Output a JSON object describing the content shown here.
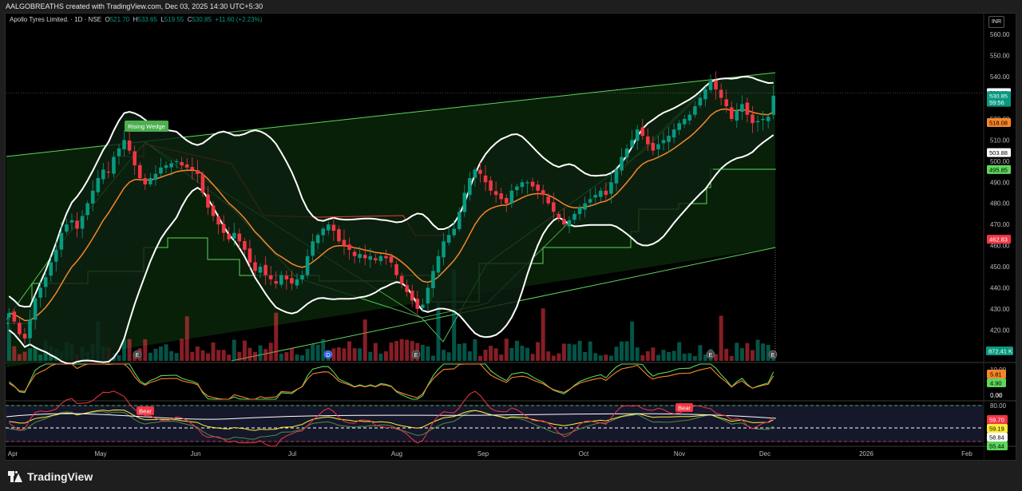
{
  "header": {
    "attribution": "AALGOBREATHS created with TradingView.com, Dec 03, 2025 14:30 UTC+5:30"
  },
  "legend": {
    "symbol": "Apollo Tyres Limited. · 1D · NSE",
    "o_label": "O",
    "o": "521.70",
    "h_label": "H",
    "h": "533.65",
    "l_label": "L",
    "l": "519.55",
    "c_label": "C",
    "c": "530.85",
    "change": "+11.60 (+2.23%)"
  },
  "currency": "INR",
  "wedge_label": "Rising Wedge",
  "bear_labels": [
    "Bear",
    "Bear"
  ],
  "event_markers": [
    "E",
    "D",
    "E",
    "E",
    "E"
  ],
  "footer": {
    "brand": "TradingView"
  },
  "colors": {
    "bull": "#089981",
    "bear": "#f23645",
    "bb": "#ffffff",
    "ema": "#f7862a",
    "trend": "#5cd65c",
    "wedge_fill": "#0b2b0b",
    "zone_fill": "#0d1f10",
    "rsi_bg": "#15172a"
  },
  "chart_data": [
    {
      "type": "candlestick",
      "x_labels": [
        "Apr",
        "May",
        "Jun",
        "Jul",
        "Aug",
        "Sep",
        "Oct",
        "Nov",
        "Dec",
        "2026",
        "Feb"
      ],
      "y_ticks": [
        560,
        550,
        540,
        520,
        510,
        500,
        490,
        480,
        470,
        460,
        450,
        440,
        430,
        420,
        410
      ],
      "ylim": [
        405,
        565
      ],
      "price_badges": [
        {
          "label": "532.28",
          "value": 532.28,
          "color": "#ffffff",
          "text": "#000000"
        },
        {
          "label": "530.85",
          "value": 530.85,
          "color": "#089981",
          "text": "#ffffff"
        },
        {
          "label": "59:56",
          "value": 527.7,
          "color": "#089981",
          "text": "#ffffff"
        },
        {
          "label": "518.08",
          "value": 518.08,
          "color": "#f7862a",
          "text": "#000000"
        },
        {
          "label": "503.88",
          "value": 503.88,
          "color": "#ffffff",
          "text": "#000000"
        },
        {
          "label": "495.85",
          "value": 495.85,
          "color": "#5cd65c",
          "text": "#000000"
        },
        {
          "label": "462.83",
          "value": 462.83,
          "color": "#f23645",
          "text": "#ffffff"
        }
      ],
      "volume_badge": "872.41 K",
      "close": [
        428,
        424,
        418,
        416,
        425,
        435,
        440,
        445,
        452,
        458,
        466,
        470,
        472,
        468,
        474,
        480,
        486,
        492,
        496,
        495,
        502,
        506,
        510,
        505,
        498,
        492,
        489,
        492,
        494,
        497,
        498,
        499,
        500,
        498,
        497,
        496,
        494,
        485,
        478,
        474,
        470,
        466,
        463,
        466,
        462,
        458,
        452,
        448,
        450,
        446,
        444,
        442,
        446,
        444,
        442,
        444,
        446,
        455,
        462,
        465,
        468,
        470,
        467,
        462,
        460,
        458,
        455,
        456,
        454,
        455,
        453,
        455,
        454,
        452,
        446,
        442,
        438,
        434,
        430,
        432,
        440,
        448,
        455,
        462,
        465,
        468,
        476,
        485,
        492,
        496,
        494,
        490,
        486,
        484,
        482,
        480,
        486,
        488,
        490,
        490,
        488,
        486,
        484,
        480,
        476,
        473,
        470,
        472,
        475,
        478,
        480,
        482,
        484,
        486,
        484,
        490,
        496,
        502,
        506,
        510,
        515,
        512,
        508,
        505,
        508,
        510,
        512,
        515,
        518,
        520,
        522,
        526,
        530,
        534,
        538,
        534,
        530,
        526,
        520,
        524,
        527,
        522,
        518,
        519,
        520,
        521,
        531
      ],
      "ema": 518.08,
      "bb_upper": 532.28,
      "bb_lower": 503.88
    },
    {
      "type": "line",
      "name": "",
      "y_ticks": [
        10.0,
        0.0
      ],
      "badges": [
        {
          "label": "5.81",
          "color": "#f7862a"
        },
        {
          "label": "4.90",
          "color": "#5cd65c"
        },
        {
          "label": "0.00",
          "color": "none"
        }
      ]
    },
    {
      "type": "line",
      "name": "",
      "y_ticks": [
        80.0
      ],
      "badges": [
        {
          "label": "59.70",
          "color": "#f23645"
        },
        {
          "label": "59.19",
          "color": "#ffeb3b"
        },
        {
          "label": "58.84",
          "color": "#ffffff"
        },
        {
          "label": "55.44",
          "color": "#5cd65c"
        }
      ]
    }
  ]
}
